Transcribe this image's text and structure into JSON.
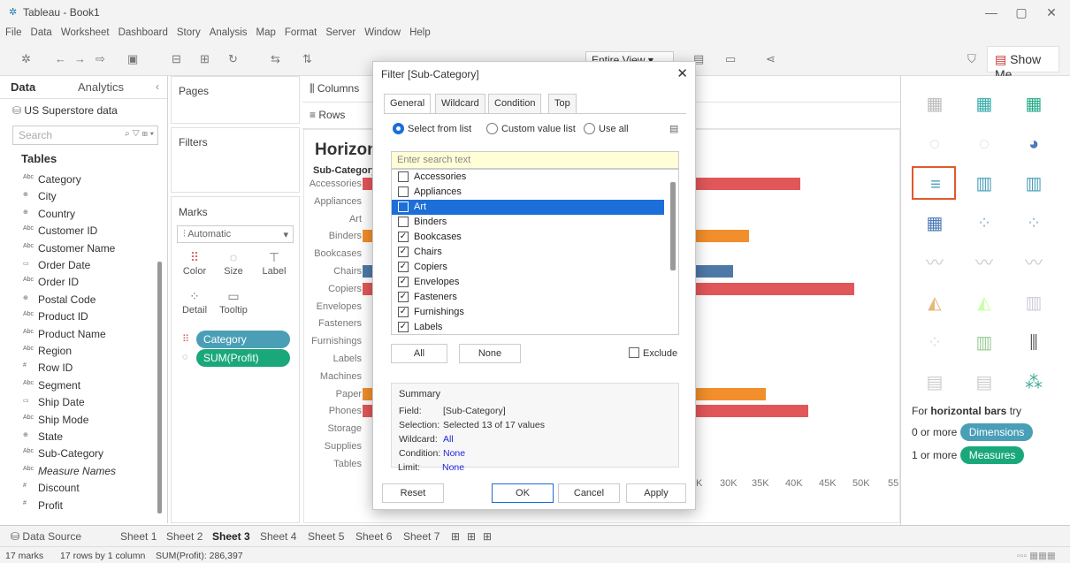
{
  "window": {
    "title": "Tableau - Book1",
    "minimize": "—",
    "restore": "▢",
    "close": "✕"
  },
  "menu": [
    "File",
    "Data",
    "Worksheet",
    "Dashboard",
    "Story",
    "Analysis",
    "Map",
    "Format",
    "Server",
    "Window",
    "Help"
  ],
  "toolbar": {
    "fit_label": "Entire View",
    "show_me_label": "Show Me"
  },
  "data_pane": {
    "tab_data": "Data",
    "tab_analytics": "Analytics",
    "datasource": "US Superstore data",
    "search_placeholder": "Search",
    "tables_label": "Tables",
    "fields": [
      {
        "icon": "Abc",
        "name": "Category"
      },
      {
        "icon": "⊕",
        "name": "City"
      },
      {
        "icon": "⊕",
        "name": "Country"
      },
      {
        "icon": "Abc",
        "name": "Customer ID"
      },
      {
        "icon": "Abc",
        "name": "Customer Name"
      },
      {
        "icon": "▭",
        "name": "Order Date"
      },
      {
        "icon": "Abc",
        "name": "Order ID"
      },
      {
        "icon": "⊕",
        "name": "Postal Code"
      },
      {
        "icon": "Abc",
        "name": "Product ID"
      },
      {
        "icon": "Abc",
        "name": "Product Name"
      },
      {
        "icon": "Abc",
        "name": "Region"
      },
      {
        "icon": "#",
        "name": "Row ID"
      },
      {
        "icon": "Abc",
        "name": "Segment"
      },
      {
        "icon": "▭",
        "name": "Ship Date"
      },
      {
        "icon": "Abc",
        "name": "Ship Mode"
      },
      {
        "icon": "⊕",
        "name": "State"
      },
      {
        "icon": "Abc",
        "name": "Sub-Category"
      },
      {
        "icon": "Abc",
        "name": "Measure Names"
      },
      {
        "icon": "#",
        "name": "Discount"
      },
      {
        "icon": "#",
        "name": "Profit"
      }
    ]
  },
  "shelves": {
    "pages": "Pages",
    "filters": "Filters",
    "marks": "Marks",
    "mark_type": "Automatic",
    "marks_buttons": [
      "Color",
      "Size",
      "Label",
      "Detail",
      "Tooltip"
    ],
    "pills": [
      "Category",
      "SUM(Profit)"
    ],
    "columns": "Columns",
    "rows": "Rows"
  },
  "view": {
    "title": "Horizon",
    "subcategory_header": "Sub-Category",
    "categories": [
      "Accessories",
      "Appliances",
      "Art",
      "Binders",
      "Bookcases",
      "Chairs",
      "Copiers",
      "Envelopes",
      "Fasteners",
      "Furnishings",
      "Labels",
      "Machines",
      "Paper",
      "Phones",
      "Storage",
      "Supplies",
      "Tables"
    ],
    "axis_ticks": [
      "K",
      "30K",
      "35K",
      "40K",
      "45K",
      "50K",
      "55"
    ]
  },
  "bars": [
    {
      "category": "Accessories",
      "color": "#e15759",
      "end": 0.92
    },
    {
      "category": "Binders",
      "color": "#f28e2b",
      "end": 0.825
    },
    {
      "category": "Chairs",
      "color": "#4e79a7",
      "end": 0.795
    },
    {
      "category": "Copiers",
      "color": "#e15759",
      "end": 1.02
    },
    {
      "category": "Paper",
      "color": "#f28e2b",
      "end": 0.855
    },
    {
      "category": "Phones",
      "color": "#e15759",
      "end": 0.935
    }
  ],
  "show_me": {
    "hint_prefix": "For",
    "hint_bold": "horizontal bars",
    "hint_suffix": "try",
    "dim_prefix": "0 or more",
    "dim_pill": "Dimensions",
    "meas_prefix": "1 or more",
    "meas_pill": "Measures"
  },
  "sheets": [
    "Data Source",
    "Sheet 1",
    "Sheet 2",
    "Sheet 3",
    "Sheet 4",
    "Sheet 5",
    "Sheet 6",
    "Sheet 7"
  ],
  "status": {
    "marks": "17 marks",
    "rows": "17 rows by 1 column",
    "sum": "SUM(Profit): 286,397"
  },
  "dialog": {
    "title": "Filter [Sub-Category]",
    "tabs": [
      "General",
      "Wildcard",
      "Condition",
      "Top"
    ],
    "radio_select": "Select from list",
    "radio_custom": "Custom value list",
    "radio_all": "Use all",
    "search_placeholder": "Enter search text",
    "items": [
      {
        "label": "Accessories",
        "checked": false
      },
      {
        "label": "Appliances",
        "checked": false
      },
      {
        "label": "Art",
        "checked": false,
        "selected": true
      },
      {
        "label": "Binders",
        "checked": false
      },
      {
        "label": "Bookcases",
        "checked": true
      },
      {
        "label": "Chairs",
        "checked": true
      },
      {
        "label": "Copiers",
        "checked": true
      },
      {
        "label": "Envelopes",
        "checked": true
      },
      {
        "label": "Fasteners",
        "checked": true
      },
      {
        "label": "Furnishings",
        "checked": true
      },
      {
        "label": "Labels",
        "checked": true
      }
    ],
    "all_btn": "All",
    "none_btn": "None",
    "exclude_label": "Exclude",
    "summary_title": "Summary",
    "summary": {
      "field_k": "Field:",
      "field_v": "[Sub-Category]",
      "selection_k": "Selection:",
      "selection_v": "Selected 13 of 17 values",
      "wildcard_k": "Wildcard:",
      "wildcard_v": "All",
      "condition_k": "Condition:",
      "condition_v": "None",
      "limit_k": "Limit:",
      "limit_v": "None"
    },
    "reset_btn": "Reset",
    "ok_btn": "OK",
    "cancel_btn": "Cancel",
    "apply_btn": "Apply"
  }
}
